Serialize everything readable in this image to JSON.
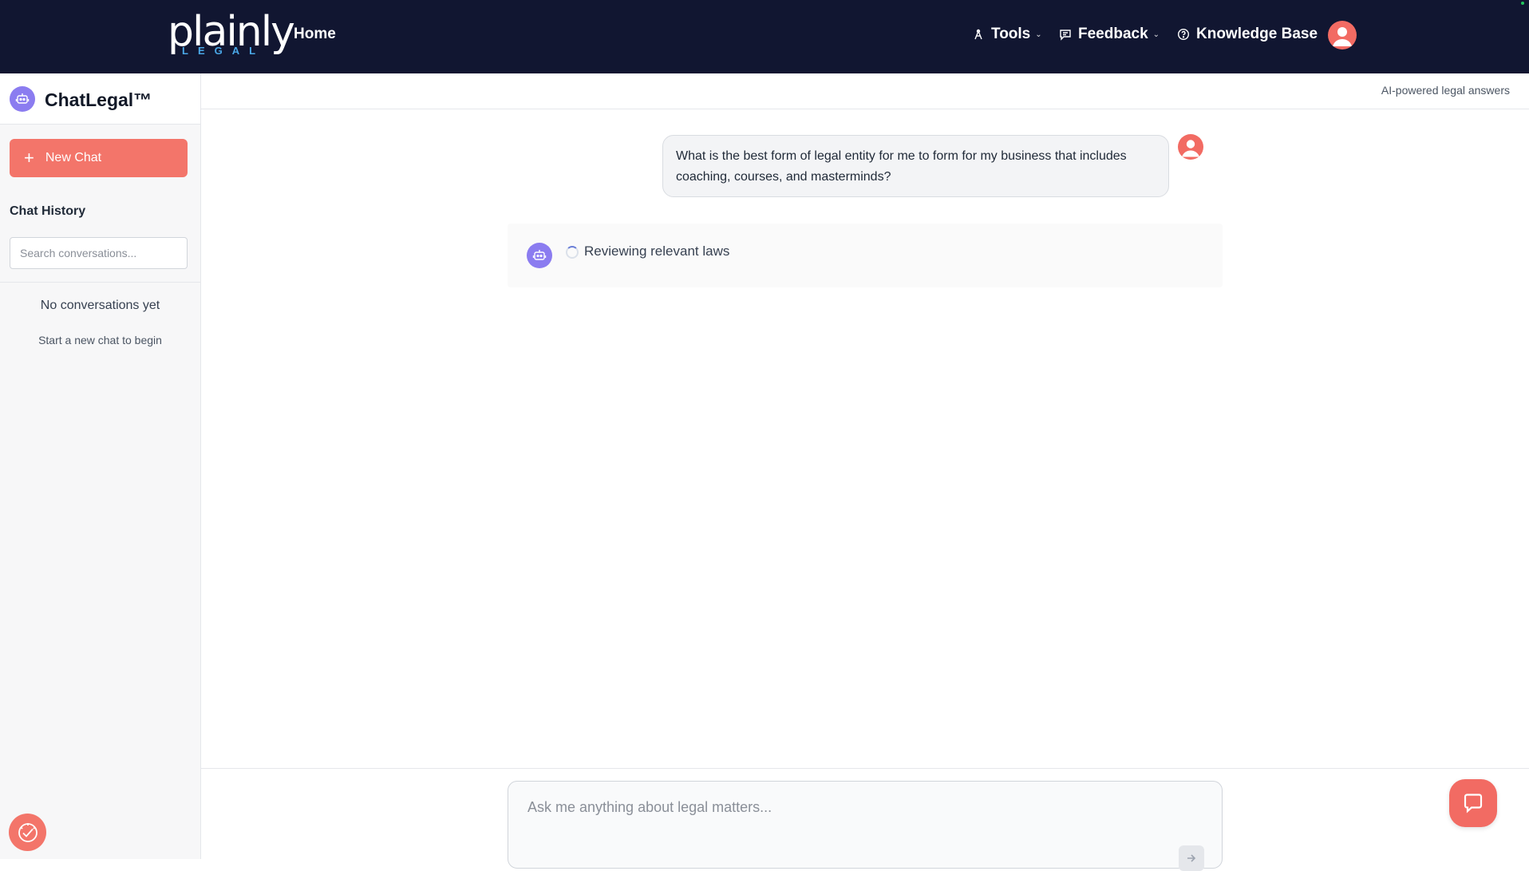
{
  "nav": {
    "logo_word": "plainly",
    "logo_sub": "LEGAL",
    "home": "Home",
    "tools": "Tools",
    "feedback": "Feedback",
    "knowledge_base": "Knowledge Base"
  },
  "sidebar": {
    "title": "ChatLegal™",
    "new_chat": "New Chat",
    "history_label": "Chat History",
    "search_placeholder": "Search conversations...",
    "empty_title": "No conversations yet",
    "empty_sub": "Start a new chat to begin"
  },
  "main": {
    "tagline": "AI-powered legal answers",
    "user_message": "What is the best form of legal entity for me to form for my business that includes coaching, courses, and masterminds?",
    "bot_status": "Reviewing relevant laws",
    "composer_placeholder": "Ask me anything about legal matters..."
  },
  "colors": {
    "nav_bg": "#111631",
    "accent": "#f3756a",
    "bot_purple": "#8b7cf0",
    "logo_blue": "#4aa8e8"
  },
  "icons": [
    "tools-icon",
    "chat-bubble-icon",
    "help-circle-icon",
    "user-avatar-icon",
    "robot-icon",
    "plus-icon",
    "spinner-icon",
    "send-icon",
    "accessibility-icon",
    "chat-support-icon",
    "chevron-down-icon"
  ]
}
